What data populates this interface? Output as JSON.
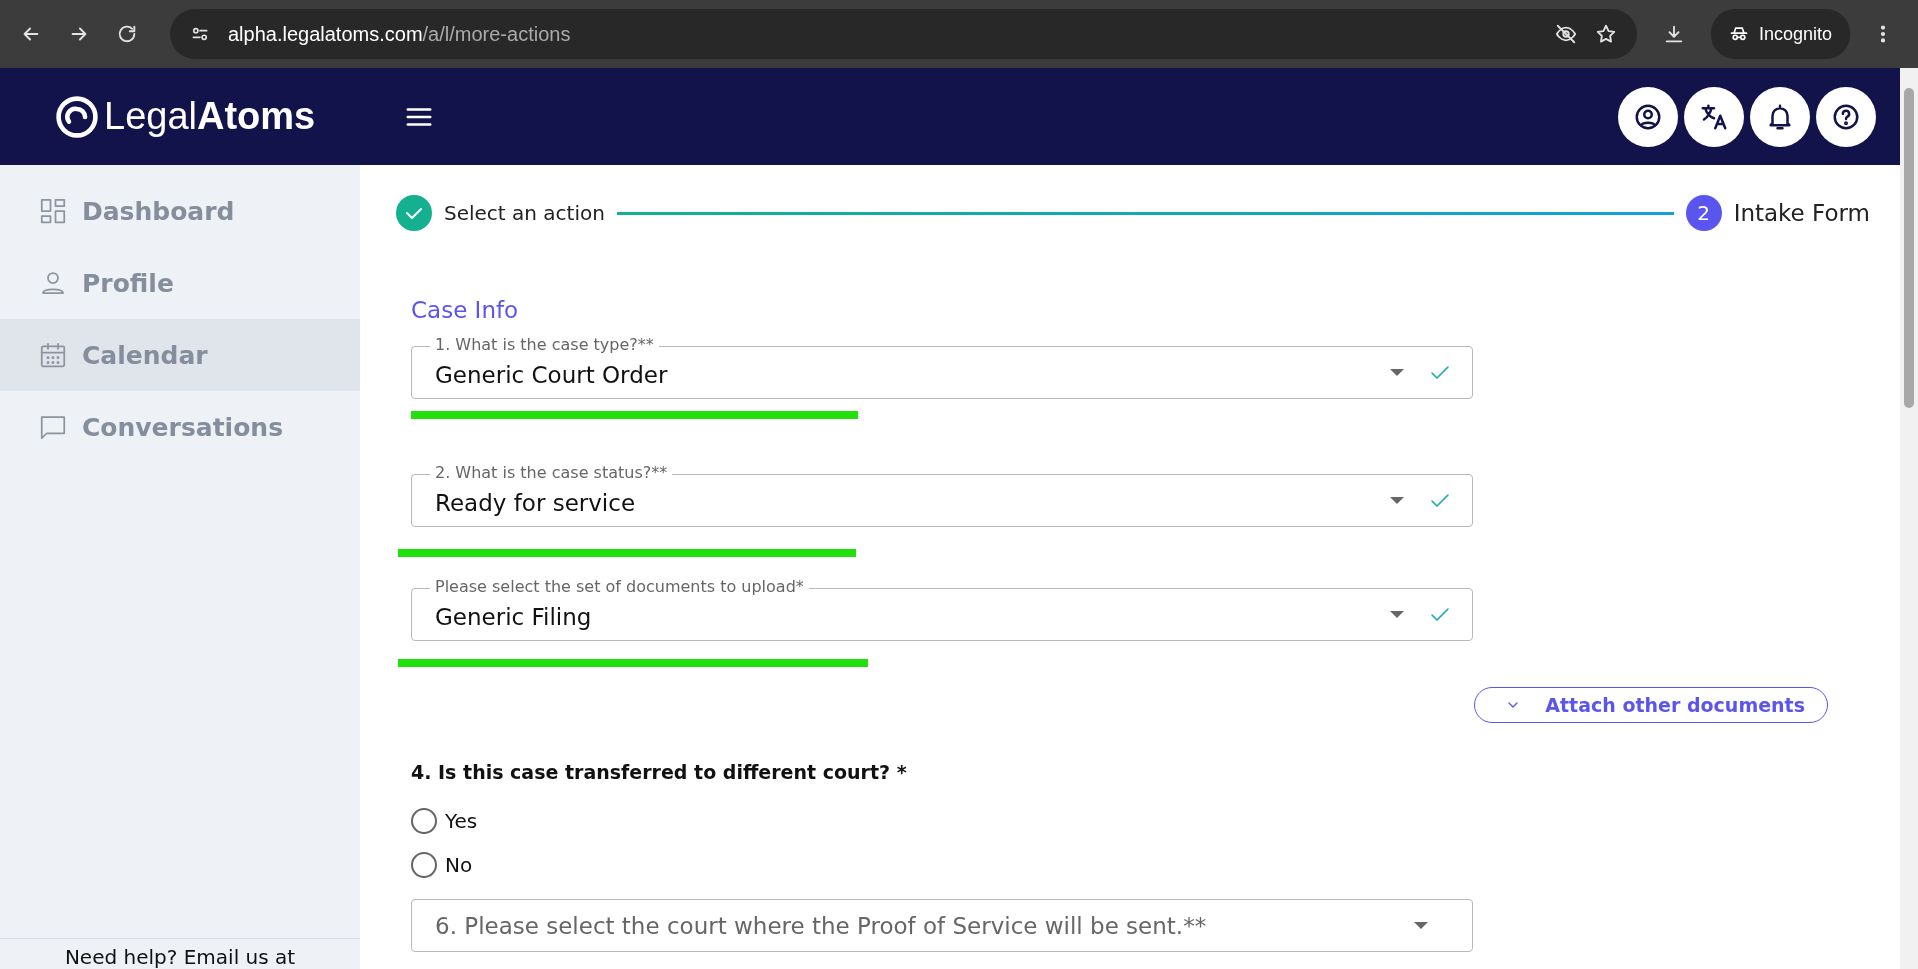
{
  "browser": {
    "url_host": "alpha.legalatoms.com",
    "url_path": "/a/l/more-actions",
    "profile_label": "Incognito"
  },
  "header": {
    "logo": "Legal**Atoms**"
  },
  "sidebar": {
    "items": [
      {
        "label": "Dashboard",
        "selected": false
      },
      {
        "label": "Profile",
        "selected": false
      },
      {
        "label": "Calendar",
        "selected": true
      },
      {
        "label": "Conversations",
        "selected": false
      }
    ],
    "footer": "Need help? Email us at"
  },
  "stepper": {
    "steps": [
      {
        "label": "Select an action",
        "completed": true
      },
      {
        "label": "Intake Form",
        "number": "2",
        "completed": false
      }
    ]
  },
  "section_title": "Case Info",
  "fields": [
    {
      "label": "1. What is the case type?**",
      "value": "Generic Court Order",
      "valid": true
    },
    {
      "label": "2. What is the case status?**",
      "value": "Ready for service",
      "valid": true
    },
    {
      "label": "Please select the set of documents to upload*",
      "value": "Generic Filing",
      "valid": true
    }
  ],
  "attach_button": "Attach other documents",
  "question": {
    "text": "4. Is this case transferred to different court? *",
    "options": [
      {
        "label": "Yes",
        "selected": false
      },
      {
        "label": "No",
        "selected": false
      }
    ]
  },
  "court_select": {
    "placeholder": "6. Please select the court where the Proof of Service will be sent.**"
  }
}
